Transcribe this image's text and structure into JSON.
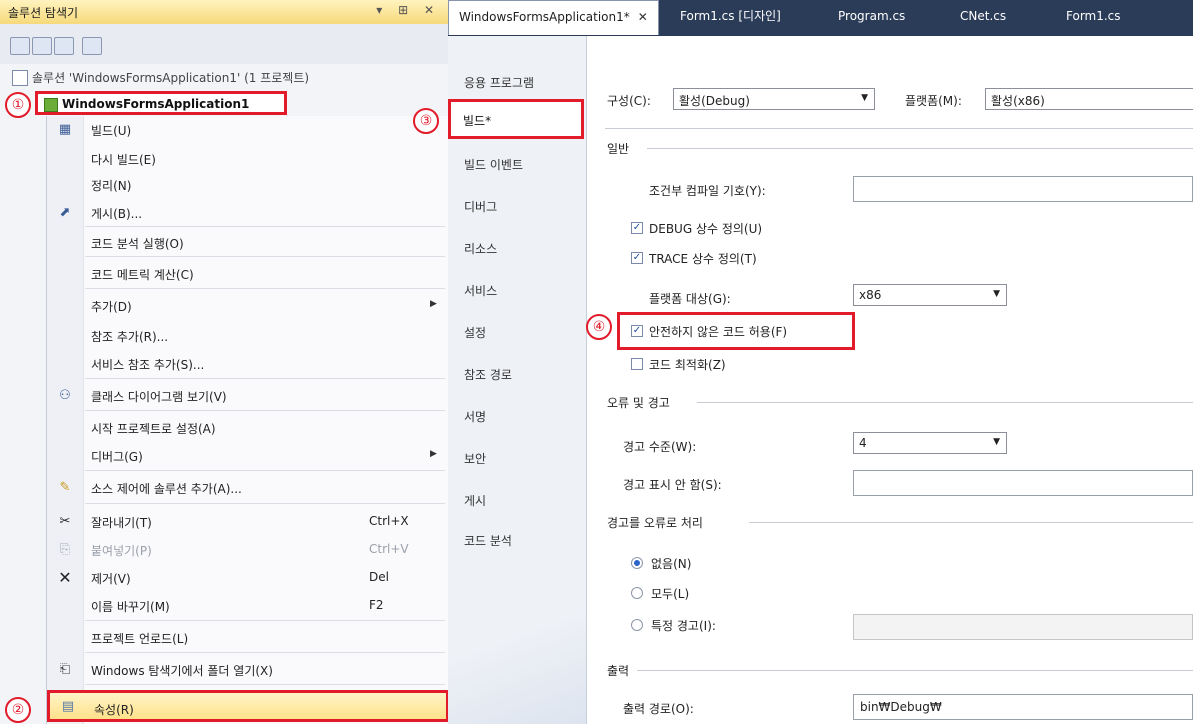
{
  "solution_explorer": {
    "title": "솔루션 탐색기",
    "title_controls": "▾ ⊞ ✕",
    "solution_label": "솔루션 'WindowsFormsApplication1' (1 프로젝트)",
    "project_label": "WindowsFormsApplication1"
  },
  "context_menu": {
    "items": [
      {
        "label": "빌드(U)",
        "icon": "build-icon",
        "glyph": "▦"
      },
      {
        "label": "다시 빌드(E)"
      },
      {
        "label": "정리(N)"
      },
      {
        "label": "게시(B)...",
        "icon": "publish-icon",
        "glyph": "⬈"
      },
      {
        "label": "코드 분석 실행(O)"
      },
      {
        "label": "코드 메트릭 계산(C)"
      },
      {
        "label": "추가(D)",
        "submenu": true
      },
      {
        "label": "참조 추가(R)..."
      },
      {
        "label": "서비스 참조 추가(S)..."
      },
      {
        "label": "클래스 다이어그램 보기(V)",
        "icon": "class-diagram-icon",
        "glyph": "⚇"
      },
      {
        "label": "시작 프로젝트로 설정(A)"
      },
      {
        "label": "디버그(G)",
        "submenu": true
      },
      {
        "label": "소스 제어에 솔루션 추가(A)...",
        "icon": "source-control-icon",
        "glyph": "✎"
      },
      {
        "label": "잘라내기(T)",
        "shortcut": "Ctrl+X",
        "icon": "cut-icon",
        "glyph": "✂"
      },
      {
        "label": "붙여넣기(P)",
        "shortcut": "Ctrl+V",
        "icon": "paste-icon",
        "glyph": "⎘",
        "disabled": true
      },
      {
        "label": "제거(V)",
        "shortcut": "Del",
        "icon": "remove-icon",
        "glyph": "✕"
      },
      {
        "label": "이름 바꾸기(M)",
        "shortcut": "F2"
      },
      {
        "label": "프로젝트 언로드(L)"
      },
      {
        "label": "Windows 탐색기에서 폴더 열기(X)",
        "icon": "open-folder-icon",
        "glyph": "⎗"
      }
    ],
    "properties_label": "속성(R)"
  },
  "callouts": [
    "①",
    "②",
    "③",
    "④"
  ],
  "tabs": [
    {
      "label": "WindowsFormsApplication1*",
      "close": "✕",
      "active": true
    },
    {
      "label": "Form1.cs [디자인]"
    },
    {
      "label": "Program.cs"
    },
    {
      "label": "CNet.cs"
    },
    {
      "label": "Form1.cs"
    }
  ],
  "property_nav": {
    "items": [
      "응용 프로그램",
      "빌드*",
      "빌드 이벤트",
      "디버그",
      "리소스",
      "서비스",
      "설정",
      "참조 경로",
      "서명",
      "보안",
      "게시",
      "코드 분석"
    ],
    "selected": "빌드*"
  },
  "build_page": {
    "config_label": "구성(C):",
    "config_value": "활성(Debug)",
    "platform_label": "플랫폼(M):",
    "platform_value": "활성(x86)",
    "general_section": "일반",
    "conditional_symbols_label": "조건부 컴파일 기호(Y):",
    "conditional_symbols_value": "",
    "define_debug": {
      "label": "DEBUG 상수 정의(U)",
      "checked": true
    },
    "define_trace": {
      "label": "TRACE 상수 정의(T)",
      "checked": true
    },
    "platform_target_label": "플랫폼 대상(G):",
    "platform_target_value": "x86",
    "allow_unsafe": {
      "label": "안전하지 않은 코드 허용(F)",
      "checked": true
    },
    "optimize": {
      "label": "코드 최적화(Z)",
      "checked": false
    },
    "errors_section": "오류 및 경고",
    "warning_level_label": "경고 수준(W):",
    "warning_level_value": "4",
    "suppress_warnings_label": "경고 표시 안 함(S):",
    "suppress_warnings_value": "",
    "treat_warnings_section": "경고를 오류로 처리",
    "treat_none": {
      "label": "없음(N)",
      "selected": true
    },
    "treat_all": {
      "label": "모두(L)",
      "selected": false
    },
    "treat_specific": {
      "label": "특정 경고(I):",
      "selected": false
    },
    "output_section": "출력",
    "output_path_label": "출력 경로(O):",
    "output_path_value": "bin₩Debug₩"
  },
  "colors": {
    "highlight_red": "#e21b2a",
    "tab_bar": "#2b3c59",
    "menu_hover": "#ffe18a"
  }
}
